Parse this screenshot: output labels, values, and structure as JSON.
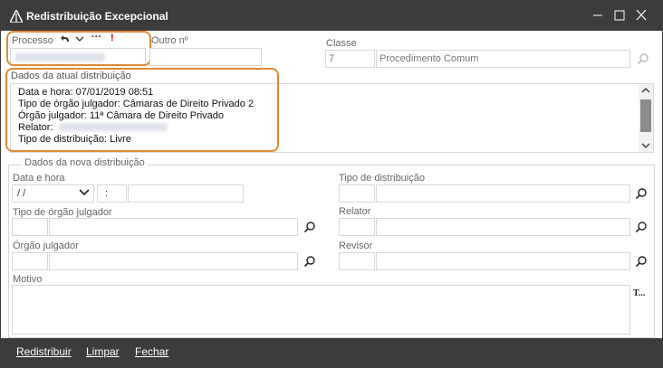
{
  "window": {
    "title": "Redistribuição Excepcional"
  },
  "processo": {
    "label": "Processo",
    "toolbar_dots": "···",
    "toolbar_alert": "!"
  },
  "outro": {
    "label": "Outro nº"
  },
  "classe": {
    "label": "Classe",
    "code": "7",
    "name": "Procedimento Comum"
  },
  "atual": {
    "legend": "Dados da atual distribuição",
    "lines": [
      "Data e hora: 07/01/2019 08:51",
      "Tipo de órgão julgador: Câmaras de Direito Privado 2",
      "Órgão julgador: 11ª Câmara de Direito Privado",
      "Relator:",
      "Tipo de distribuição: Livre"
    ]
  },
  "nova": {
    "legend": "Dados da nova distribuição",
    "data_hora_label": "Data e hora",
    "date_value": " /  /",
    "time_value": ":",
    "tipo_distribuicao_label": "Tipo de distribuição",
    "tipo_orgao_label": "Tipo de órgão julgador",
    "relator_label": "Relator",
    "orgao_label": "Órgão julgador",
    "revisor_label": "Revisor",
    "motivo_label": "Motivo",
    "motivo_tool": "T..."
  },
  "footer": {
    "redistribuir": "Redistribuir",
    "limpar": "Limpar",
    "fechar": "Fechar"
  },
  "colors": {
    "titlebar": "#3c3c3c",
    "highlight": "#e08a33"
  }
}
